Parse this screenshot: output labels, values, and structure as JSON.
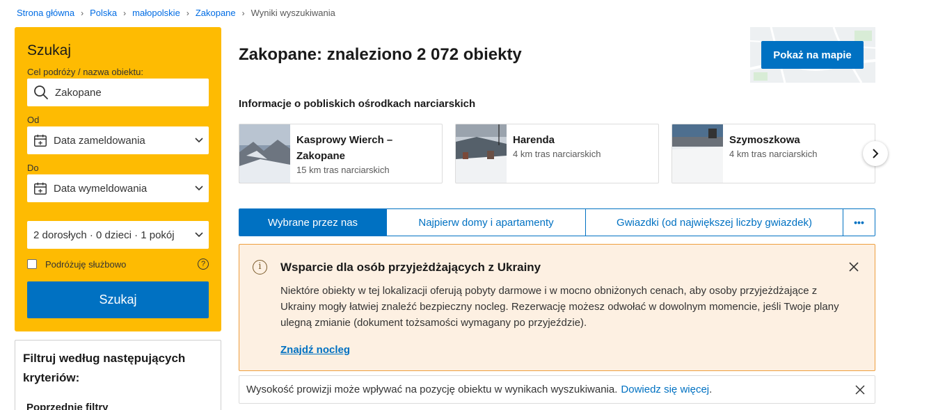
{
  "breadcrumb": {
    "items": [
      "Strona główna",
      "Polska",
      "małopolskie",
      "Zakopane"
    ],
    "current": "Wyniki wyszukiwania"
  },
  "search": {
    "title": "Szukaj",
    "destination_label": "Cel podróży / nazwa obiektu:",
    "destination_value": "Zakopane",
    "from_label": "Od",
    "checkin_value": "Data zameldowania",
    "to_label": "Do",
    "checkout_value": "Data wymeldowania",
    "guests_value": "2 dorosłych · 0 dzieci · 1 pokój",
    "business_label": "Podróżuję służbowo",
    "help_symbol": "?",
    "button_label": "Szukaj"
  },
  "filters": {
    "title": "Filtruj według następujących kryteriów:",
    "previous": "Poprzednie filtry"
  },
  "main": {
    "title": "Zakopane: znaleziono 2 072 obiekty",
    "map_button": "Pokaż na mapie",
    "ski_heading": "Informacje o pobliskich ośrodkach narciarskich",
    "ski_resorts": [
      {
        "name": "Kasprowy Wierch – Zakopane",
        "distance": "15 km tras narciarskich"
      },
      {
        "name": "Harenda",
        "distance": "4 km tras narciarskich"
      },
      {
        "name": "Szymoszkowa",
        "distance": "4 km tras narciarskich"
      }
    ],
    "sort_tabs": [
      "Wybrane przez nas",
      "Najpierw domy i apartamenty",
      "Gwiazdki (od największej liczby gwiazdek)",
      "•••"
    ],
    "ukraine": {
      "title": "Wsparcie dla osób przyjeżdżających z Ukrainy",
      "body": "Niektóre obiekty w tej lokalizacji oferują pobyty darmowe i w mocno obniżonych cenach, aby osoby przyjeżdżające z Ukrainy mogły łatwiej znaleźć bezpieczny nocleg. Rezerwację możesz odwołać w dowolnym momencie, jeśli Twoje plany ulegną zmianie (dokument tożsamości wymagany po przyjeździe).",
      "link": "Znajdź nocleg",
      "info_symbol": "i"
    },
    "commission": {
      "text": "Wysokość prowizji może wpływać na pozycję obiektu w wynikach wyszukiwania.",
      "link": "Dowiedz się więcej",
      "period": "."
    }
  },
  "colors": {
    "accent": "#0071c2",
    "search_panel": "#febb02",
    "banner_bg": "#fdf0e2",
    "banner_border": "#ee9e3e"
  }
}
